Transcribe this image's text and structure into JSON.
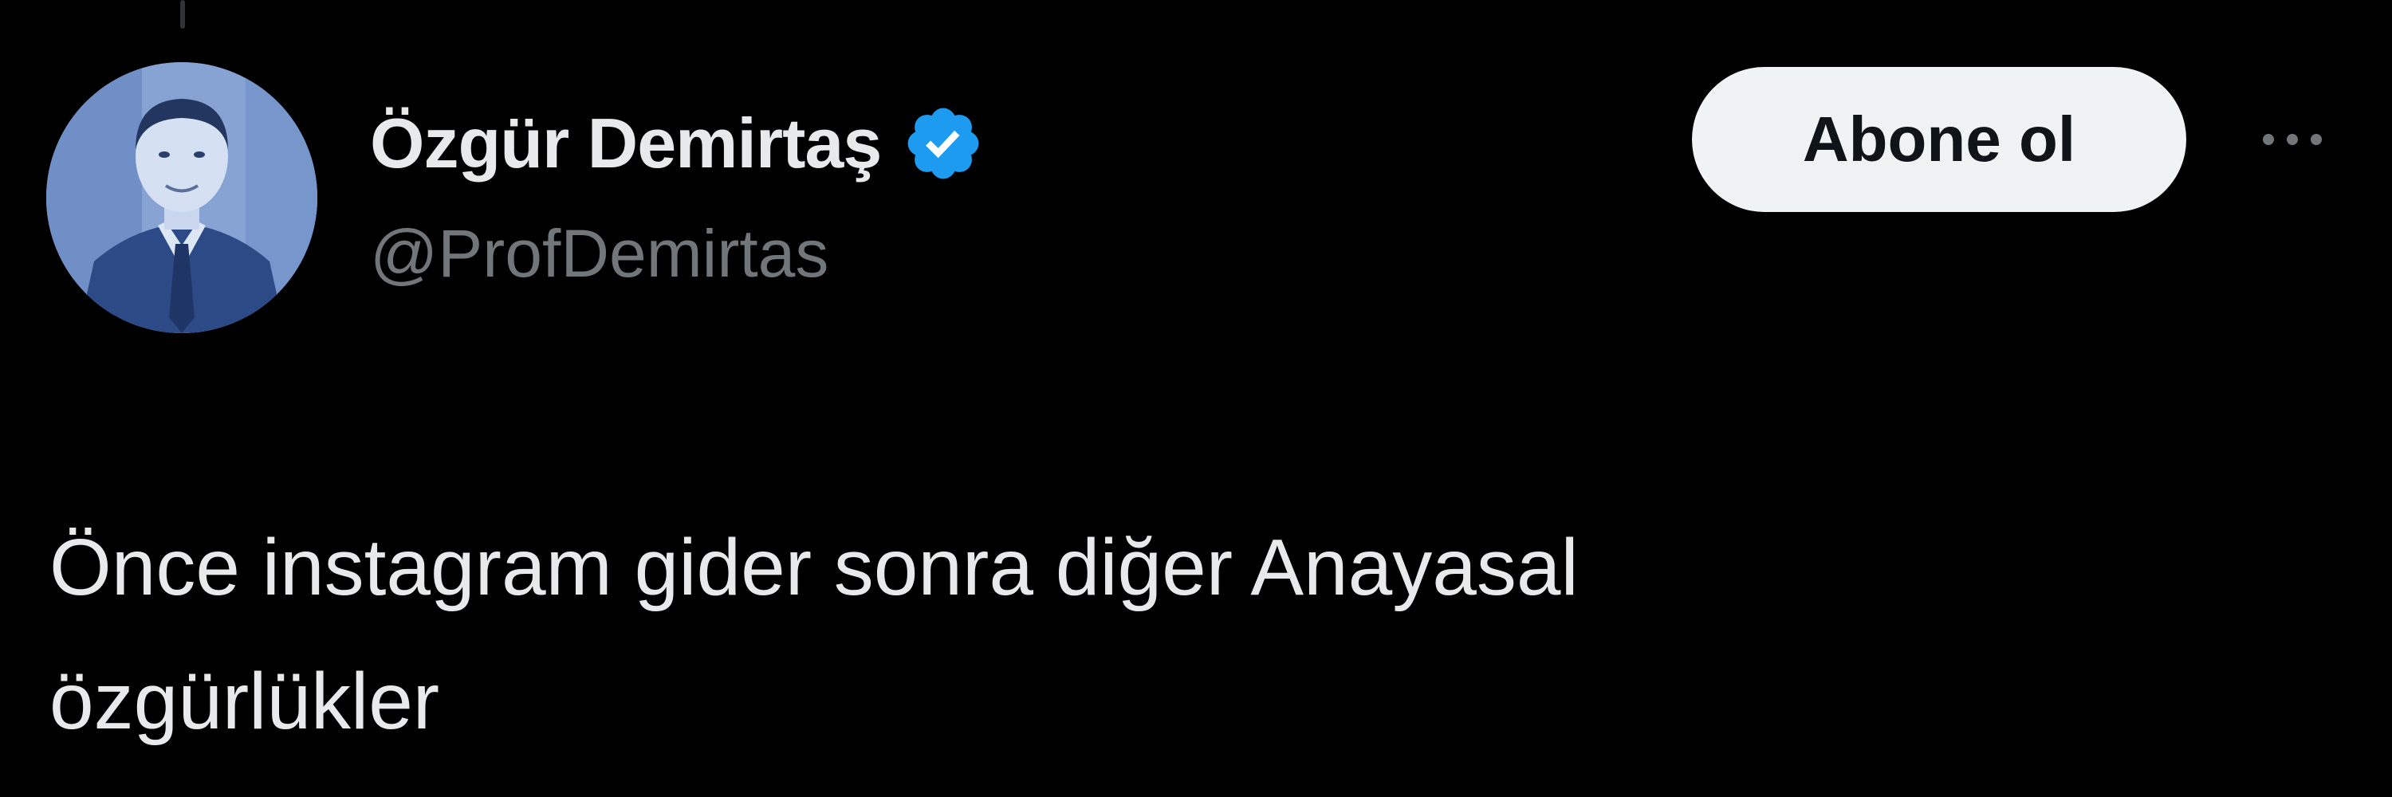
{
  "tweet": {
    "author": {
      "display_name": "Özgür Demirtaş",
      "handle": "@ProfDemirtas",
      "verified": true,
      "avatar_icon": "profile-photo"
    },
    "actions": {
      "follow_label": "Abone ol",
      "more_icon": "more-options-icon"
    },
    "text_lines": [
      "Önce instagram gider sonra diğer Anayasal",
      "özgürlükler"
    ]
  },
  "colors": {
    "background": "#000000",
    "primary_text": "#e7e9ea",
    "secondary_text": "#71767b",
    "verified_badge": "#1d9bf0",
    "follow_button_bg": "#eff3f4",
    "follow_button_text": "#0f1419"
  }
}
